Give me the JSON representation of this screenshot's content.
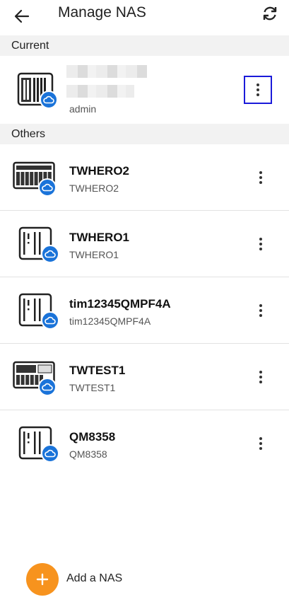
{
  "header": {
    "title": "Manage NAS"
  },
  "sections": {
    "current": "Current",
    "others": "Others"
  },
  "current_device": {
    "user": "admin"
  },
  "devices": [
    {
      "name": "TWHERO2",
      "host": "TWHERO2",
      "model": "rack"
    },
    {
      "name": "TWHERO1",
      "host": "TWHERO1",
      "model": "tower"
    },
    {
      "name": "tim12345QMPF4A",
      "host": "tim12345QMPF4A",
      "model": "tower"
    },
    {
      "name": "TWTEST1",
      "host": "TWTEST1",
      "model": "rack2"
    },
    {
      "name": "QM8358",
      "host": "QM8358",
      "model": "tower"
    }
  ],
  "footer": {
    "add_label": "Add a NAS"
  },
  "colors": {
    "accent": "#f7931e",
    "badge": "#1a73d9",
    "highlight": "#1a1ad9"
  }
}
